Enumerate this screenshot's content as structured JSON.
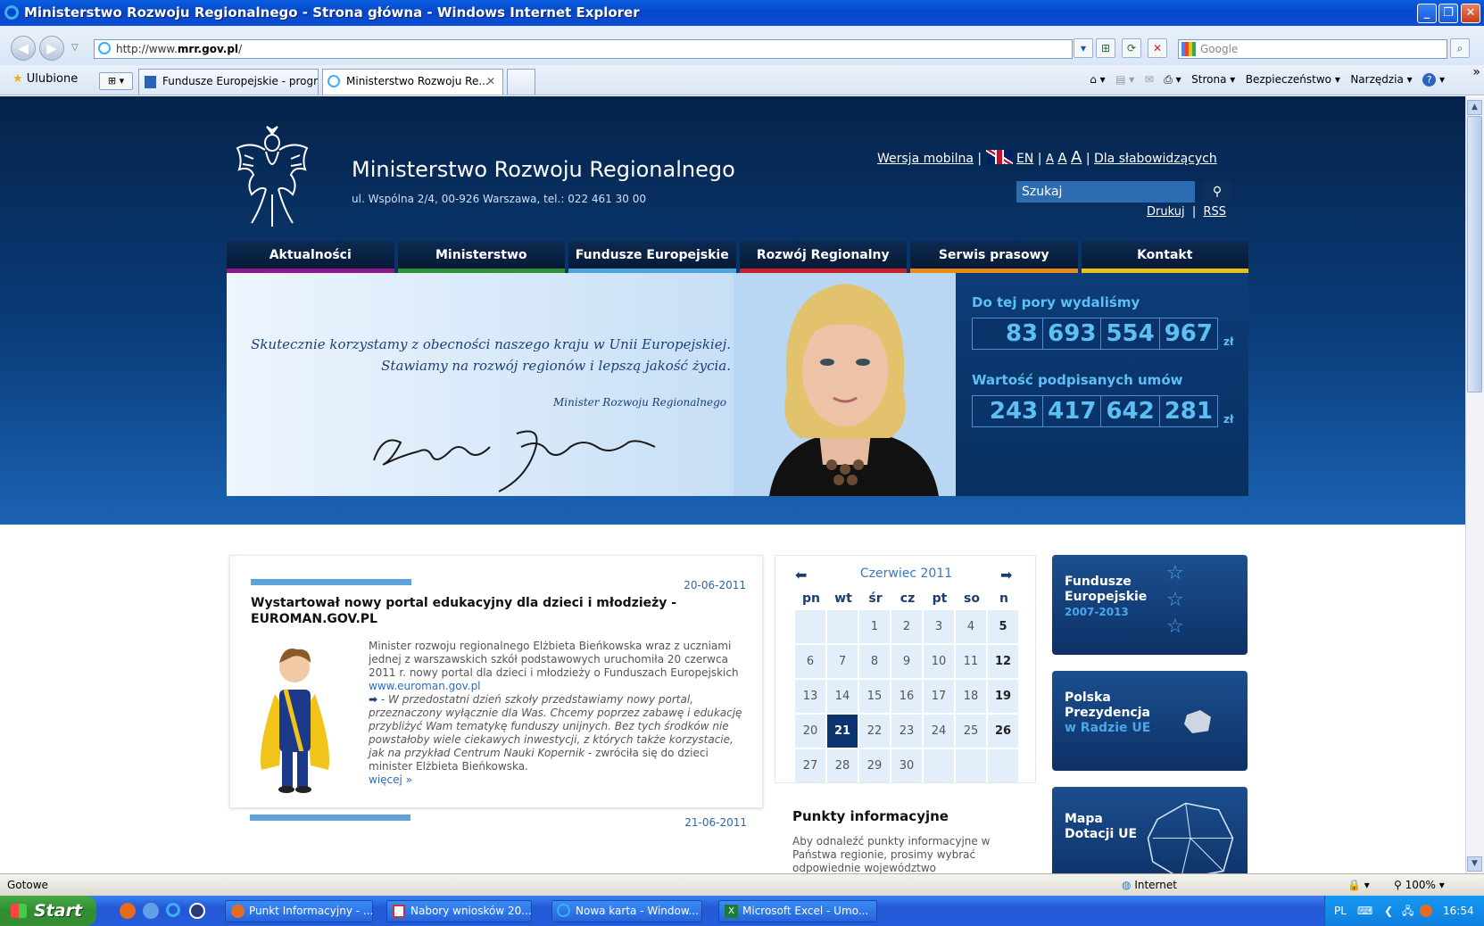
{
  "window": {
    "title": "Ministerstwo Rozwoju Regionalnego - Strona główna - Windows Internet Explorer",
    "address_prefix": "http://www.",
    "address_domain": "mrr.gov.pl",
    "address_suffix": "/",
    "search_placeholder": "Google"
  },
  "tabs": {
    "favorites_label": "Ulubione",
    "items": [
      {
        "label": "Fundusze Europejskie - progr..."
      },
      {
        "label": "Ministerstwo Rozwoju Re...",
        "close": "✕"
      }
    ]
  },
  "command_bar": {
    "page_label": "Strona ▾",
    "safety_label": "Bezpieczeństwo ▾",
    "tools_label": "Narzędzia ▾",
    "more": "»"
  },
  "site": {
    "title": "Ministerstwo Rozwoju Regionalnego",
    "address": "ul. Wspólna 2/4, 00-926 Warszawa, tel.: 022 461 30 00",
    "mobile_link": "Wersja mobilna",
    "en_link": "EN",
    "font_small": "A",
    "font_medium": "A",
    "font_large": "A",
    "impaired_link": "Dla słabowidzących",
    "search_label": "Szukaj",
    "print_link": "Drukuj",
    "rss_link": "RSS",
    "separator": "|"
  },
  "menu": [
    {
      "label": "Aktualności",
      "color": "#8a1a8e"
    },
    {
      "label": "Ministerstwo",
      "color": "#2f8f3a"
    },
    {
      "label": "Fundusze Europejskie",
      "color": "#4fa3dc"
    },
    {
      "label": "Rozwój Regionalny",
      "color": "#c8202f"
    },
    {
      "label": "Serwis prasowy",
      "color": "#e78a16"
    },
    {
      "label": "Kontakt",
      "color": "#e7c21a"
    }
  ],
  "banner": {
    "quote_line1": "Skutecznie korzystamy z obecności naszego kraju w Unii Europejskiej.",
    "quote_line2": "Stawiamy na rozwój regionów i lepszą jakość życia.",
    "minister_label": "Minister Rozwoju Regionalnego"
  },
  "stats": {
    "spent_label": "Do tej pory wydaliśmy",
    "spent_groups": [
      "83",
      "693",
      "554",
      "967"
    ],
    "contracts_label": "Wartość podpisanych umów",
    "contracts_groups": [
      "243",
      "417",
      "642",
      "281"
    ],
    "currency": "zł"
  },
  "news": [
    {
      "date": "20-06-2011",
      "title": "Wystartował nowy portal edukacyjny dla dzieci i młodzieży - EUROMAN.GOV.PL",
      "body": "Minister rozwoju regionalnego Elżbieta Bieńkowska wraz z uczniami jednej z warszawskich szkół podstawowych uruchomiła 20 czerwca 2011 r. nowy portal dla dzieci i młodzieży o Funduszach Europejskich",
      "link": "www.euroman.gov.pl",
      "quote": "- W przedostatni dzień szkoły  przedstawiamy nowy portal, przeznaczony wyłącznie dla Was. Chcemy poprzez zabawę i edukację przybliżyć Wam tematykę funduszy unijnych. Bez tych środków nie powstałoby wiele ciekawych inwestycji, z których także korzystacie, jak na przykład Centrum Nauki Kopernik",
      "after_quote": " - zwróciła się do dzieci minister Elżbieta Bieńkowska.",
      "more": "więcej »"
    },
    {
      "date": "21-06-2011"
    }
  ],
  "calendar": {
    "month": "Czerwiec 2011",
    "weekdays": [
      "pn",
      "wt",
      "śr",
      "cz",
      "pt",
      "so",
      "n"
    ],
    "weeks": [
      [
        "",
        "",
        "1",
        "2",
        "3",
        "4",
        "5"
      ],
      [
        "6",
        "7",
        "8",
        "9",
        "10",
        "11",
        "12"
      ],
      [
        "13",
        "14",
        "15",
        "16",
        "17",
        "18",
        "19"
      ],
      [
        "20",
        "21",
        "22",
        "23",
        "24",
        "25",
        "26"
      ],
      [
        "27",
        "28",
        "29",
        "30",
        "",
        "",
        ""
      ]
    ],
    "today": "21"
  },
  "punkty": {
    "title": "Punkty informacyjne",
    "text": "Aby odnaleźć punkty informacyjne w Państwa regionie, prosimy wybrać odpowiednie województwo"
  },
  "side_boxes": [
    {
      "line1": "Fundusze",
      "line2": "Europejskie",
      "line3": "2007-2013"
    },
    {
      "line1": "Polska",
      "line2": "Prezydencja",
      "line3": "w Radzie UE"
    },
    {
      "line1": "Mapa",
      "line2": "Dotacji UE",
      "line3": ""
    }
  ],
  "statusbar": {
    "status": "Gotowe",
    "zone": "Internet",
    "zoom": "100%"
  },
  "taskbar": {
    "start": "Start",
    "items": [
      {
        "label": "Punkt Informacyjny - ..."
      },
      {
        "label": "Nabory wniosków 20..."
      },
      {
        "label": "Nowa karta - Window..."
      },
      {
        "label": "Microsoft Excel - Umo..."
      }
    ],
    "lang": "PL",
    "time": "16:54"
  }
}
